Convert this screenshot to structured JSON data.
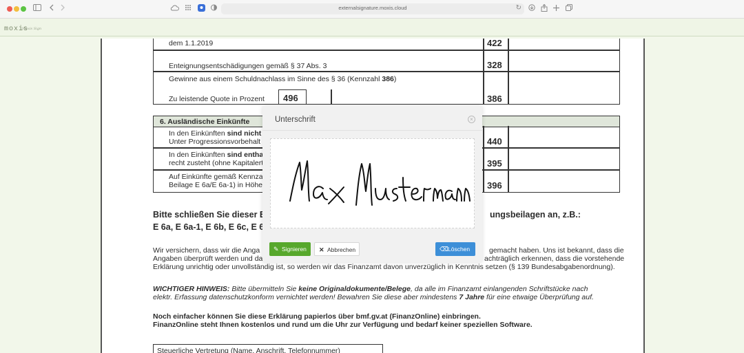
{
  "browser": {
    "url": "externalsignature.moxis.cloud",
    "icons": [
      "sidebar-icon",
      "back-icon",
      "forward-icon",
      "cloud-icon",
      "grid-icon",
      "extension-icon",
      "shield-icon",
      "reload-icon",
      "download-icon",
      "share-icon",
      "new-tab-icon",
      "tabs-icon"
    ]
  },
  "app": {
    "logo": "moxis",
    "logo_tagline": "Moxis Sign"
  },
  "document": {
    "rows": [
      {
        "label": "dem 1.1.2019",
        "code": "422"
      },
      {
        "label": "Enteignungsentschädigungen gemäß § 37 Abs. 3",
        "code": "328"
      },
      {
        "label_pre": "Gewinne aus einem Schuldnachlass im Sinne des § 36 (Kennzahl ",
        "label_bold": "386",
        "label_post": ")"
      },
      {
        "label": "Zu leistende Quote in Prozent",
        "inner_code": "496",
        "code": "386"
      }
    ],
    "section6": {
      "title": "6. Ausländische Einkünfte",
      "rows": [
        {
          "line1_pre": "In den Einkünften ",
          "line1_bold": "sind nicht",
          "line2": "Unter Progressionsvorbehalt s",
          "code": "440"
        },
        {
          "line1_pre": "In den Einkünften ",
          "line1_bold": "sind entha",
          "line2": "recht zusteht (ohne Kapitalert",
          "code": "395"
        },
        {
          "line1": "Auf Einkünfte gemäß Kennzal",
          "line2": "Beilage E 6a/E 6a-1) in Höhe",
          "code": "396"
        }
      ]
    },
    "notice_title_left": "Bitte schließen Sie dieser E",
    "notice_title_right": "ungsbeilagen an, z.B.:",
    "notice_forms": "E 6a, E 6a-1, E 6b, E 6c, E 6",
    "declaration": {
      "line1_left": "Wir versichern, dass wir die Anga",
      "line1_right": "gemacht haben. Uns ist bekannt, dass die",
      "line2_left": "Angaben überprüft werden und da",
      "line2_right": "achträglich erkennen, dass die vorstehende",
      "line3": "Erklärung unrichtig oder unvollständig ist, so werden wir das Finanzamt davon unverzüglich in Kenntnis setzen (§ 139 Bundesabgabenordnung)."
    },
    "hint": {
      "label": "WICHTIGER HINWEIS:",
      "t1": " Bitte übermitteln Sie ",
      "b1": "keine Originaldokumente/Belege",
      "t2": ", da alle im Finanzamt einlangenden Schriftstücke nach",
      "t3": "elektr. Erfassung datenschutzkonform vernichtet werden! Bewahren Sie diese aber mindestens ",
      "b2": "7 Jahre",
      "t4": " für eine etwaige Überprüfung auf."
    },
    "online_line1": "Noch einfacher können Sie diese Erklärung papierlos über bmf.gv.at (FinanzOnline) einbringen.",
    "online_line2": "FinanzOnline steht Ihnen kostenlos und rund um die Uhr zur Verfügung und bedarf keiner speziellen Software.",
    "representation_label": "Steuerliche Vertretung (Name, Anschrift, Telefonnummer)"
  },
  "modal": {
    "title": "Unterschrift",
    "signature_text": "Max Mustermann",
    "buttons": {
      "sign": "Signieren",
      "cancel": "Abbrechen",
      "clear": "Löschen"
    },
    "colors": {
      "sign": "#57a82c",
      "clear": "#3d8fd8"
    }
  }
}
